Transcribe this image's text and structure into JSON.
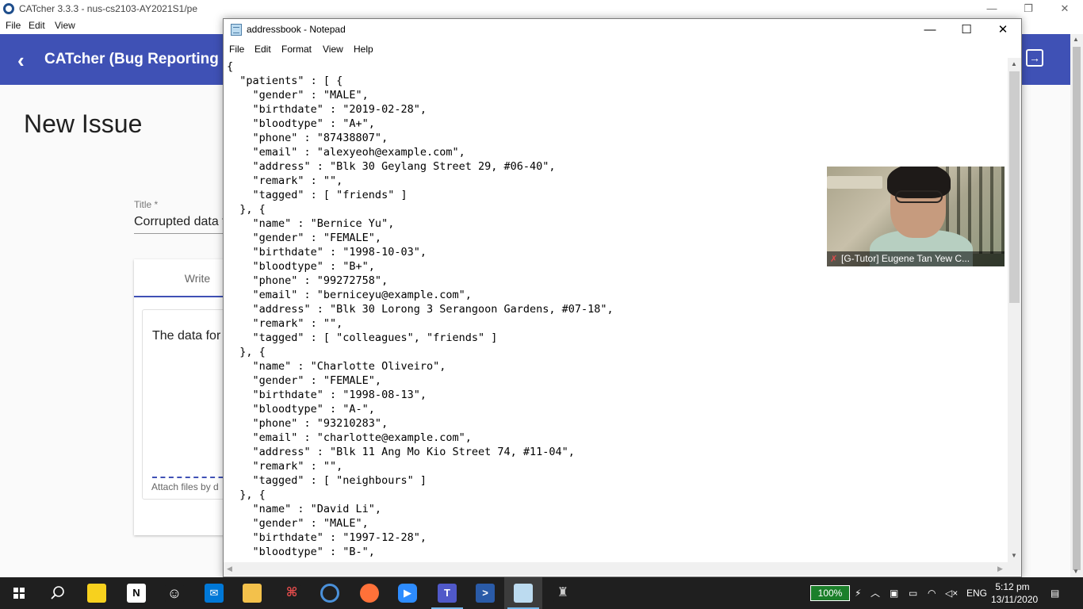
{
  "background_app": {
    "window_title": "CATcher 3.3.3 - nus-cs2103-AY2021S1/pe",
    "menu": [
      "File",
      "Edit",
      "View"
    ],
    "toolbar_title": "CATcher  (Bug Reporting",
    "page_heading": "New Issue",
    "title_label": "Title *",
    "title_value": "Corrupted data f",
    "tab_write": "Write",
    "description_preview": "The data for",
    "attach_hint": "Attach files by d"
  },
  "notepad": {
    "title": "addressbook - Notepad",
    "menu": [
      "File",
      "Edit",
      "Format",
      "View",
      "Help"
    ],
    "content_lines": [
      "{",
      "  \"patients\" : [ {",
      "    \"gender\" : \"MALE\",",
      "    \"birthdate\" : \"2019-02-28\",",
      "    \"bloodtype\" : \"A+\",",
      "    \"phone\" : \"87438807\",",
      "    \"email\" : \"alexyeoh@example.com\",",
      "    \"address\" : \"Blk 30 Geylang Street 29, #06-40\",",
      "    \"remark\" : \"\",",
      "    \"tagged\" : [ \"friends\" ]",
      "  }, {",
      "    \"name\" : \"Bernice Yu\",",
      "    \"gender\" : \"FEMALE\",",
      "    \"birthdate\" : \"1998-10-03\",",
      "    \"bloodtype\" : \"B+\",",
      "    \"phone\" : \"99272758\",",
      "    \"email\" : \"berniceyu@example.com\",",
      "    \"address\" : \"Blk 30 Lorong 3 Serangoon Gardens, #07-18\",",
      "    \"remark\" : \"\",",
      "    \"tagged\" : [ \"colleagues\", \"friends\" ]",
      "  }, {",
      "    \"name\" : \"Charlotte Oliveiro\",",
      "    \"gender\" : \"FEMALE\",",
      "    \"birthdate\" : \"1998-08-13\",",
      "    \"bloodtype\" : \"A-\",",
      "    \"phone\" : \"93210283\",",
      "    \"email\" : \"charlotte@example.com\",",
      "    \"address\" : \"Blk 11 Ang Mo Kio Street 74, #11-04\",",
      "    \"remark\" : \"\",",
      "    \"tagged\" : [ \"neighbours\" ]",
      "  }, {",
      "    \"name\" : \"David Li\",",
      "    \"gender\" : \"MALE\",",
      "    \"birthdate\" : \"1997-12-28\",",
      "    \"bloodtype\" : \"B-\","
    ]
  },
  "video_call": {
    "participant_name": "[G-Tutor] Eugene Tan Yew C...",
    "mic_status_icon": "muted-mic-icon"
  },
  "taskbar": {
    "apps": [
      {
        "name": "start",
        "icon": "windows-logo-icon"
      },
      {
        "name": "search",
        "icon": "search-icon"
      },
      {
        "name": "sticky-notes",
        "icon": "sticky-notes-icon",
        "color": "#f7d11e"
      },
      {
        "name": "notion",
        "icon": "notion-icon"
      },
      {
        "name": "octocat",
        "icon": "octocat-icon"
      },
      {
        "name": "mail",
        "icon": "mail-icon",
        "color": "#0078d7"
      },
      {
        "name": "file-explorer",
        "icon": "folder-icon",
        "color": "#f3c14b"
      },
      {
        "name": "acrobat",
        "icon": "acrobat-icon",
        "color": "#d9261c"
      },
      {
        "name": "catcher",
        "icon": "catcher-icon"
      },
      {
        "name": "firefox",
        "icon": "firefox-icon",
        "color": "#ff7139"
      },
      {
        "name": "zoom",
        "icon": "zoom-icon",
        "color": "#2d8cff"
      },
      {
        "name": "teams",
        "icon": "teams-icon",
        "color": "#5059c9"
      },
      {
        "name": "powershell",
        "icon": "powershell-icon",
        "color": "#2a5ba8"
      },
      {
        "name": "notepad",
        "icon": "notepad-icon"
      },
      {
        "name": "lantern",
        "icon": "lantern-icon"
      }
    ],
    "battery_level": "100%",
    "language": "ENG",
    "time": "5:12 pm",
    "date": "13/11/2020"
  }
}
